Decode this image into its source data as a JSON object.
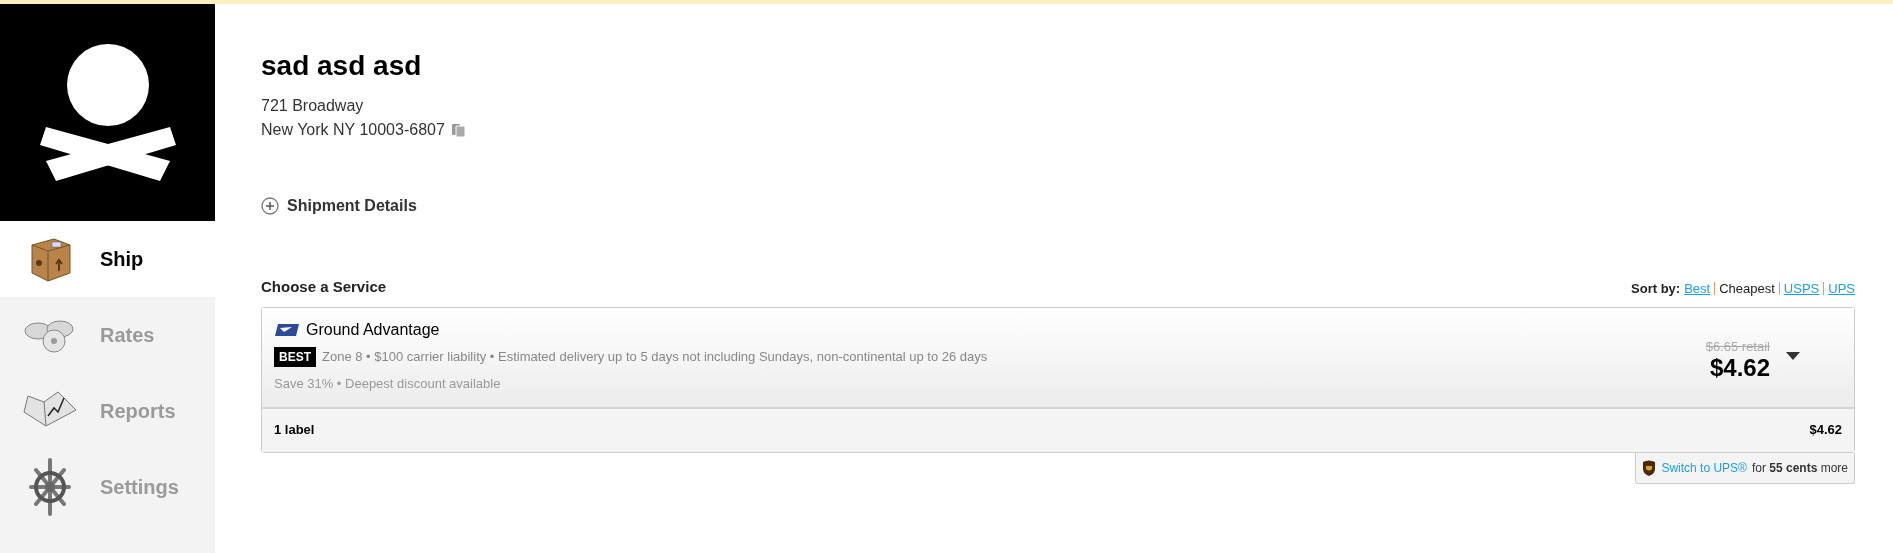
{
  "sidebar": {
    "items": [
      {
        "label": "Ship",
        "kind": "crate",
        "selected": true
      },
      {
        "label": "Rates",
        "kind": "coins",
        "selected": false
      },
      {
        "label": "Reports",
        "kind": "book",
        "selected": false
      },
      {
        "label": "Settings",
        "kind": "wheel",
        "selected": false
      }
    ]
  },
  "recipient": {
    "name": "sad asd asd",
    "address_lines": [
      "721 Broadway",
      "New York NY 10003-6807"
    ]
  },
  "shipment_details": {
    "label": "Shipment Details",
    "expanded": false
  },
  "services": {
    "title": "Choose a Service",
    "sort_label": "Sort by:",
    "sort_options": [
      {
        "label": "Best",
        "selected": false
      },
      {
        "label": "Cheapest",
        "selected": true
      },
      {
        "label": "USPS",
        "selected": false
      },
      {
        "label": "UPS",
        "selected": false
      }
    ],
    "card": {
      "name": "Ground Advantage",
      "badge": "BEST",
      "details": "Zone 8 • $100 carrier liability • Estimated delivery up to 5 days not including Sundays, non-continental up to 26 days",
      "savings": "Save 31% • Deepest discount available",
      "retail": "$6.65 retail",
      "price": "$4.62",
      "footer_label": "1 label",
      "footer_price": "$4.62"
    },
    "switch": {
      "link": "Switch to UPS®",
      "middle": "for",
      "amount": "55 cents",
      "end": "more"
    }
  }
}
